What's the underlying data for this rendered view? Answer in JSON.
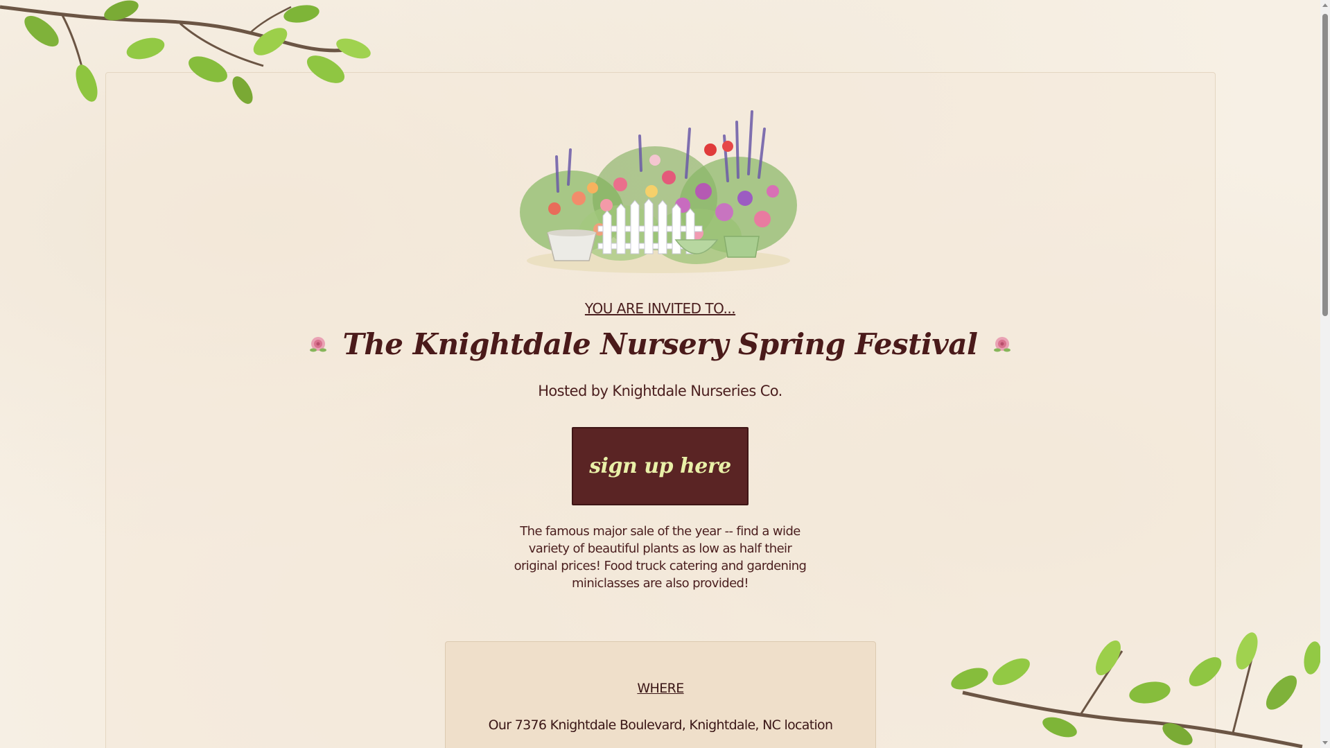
{
  "header": {
    "invited_text": "YOU ARE INVITED TO...",
    "title": "The Knightdale Nursery Spring Festival",
    "host_text": "Hosted by Knightdale Nurseries Co."
  },
  "cta": {
    "signup_label": "sign up here"
  },
  "main": {
    "description": "The famous major sale of the year -- find a wide variety of beautiful plants as low as half their original prices! Food truck catering and gardening miniclasses are also provided!"
  },
  "where": {
    "title": "WHERE",
    "text": "Our 7376 Knightdale Boulevard, Knightdale, NC location"
  },
  "icons": {
    "title_left": "rose-icon",
    "title_right": "rose-icon",
    "hero": "garden-illustration",
    "corner_top_left": "leafy-branch",
    "corner_bottom_right": "leafy-branch"
  },
  "colors": {
    "background": "#f7f0e5",
    "text": "#4a1e1e",
    "button_bg": "#5a2424",
    "button_text": "#e9f0a8",
    "where_card_bg": "#efdfca"
  }
}
